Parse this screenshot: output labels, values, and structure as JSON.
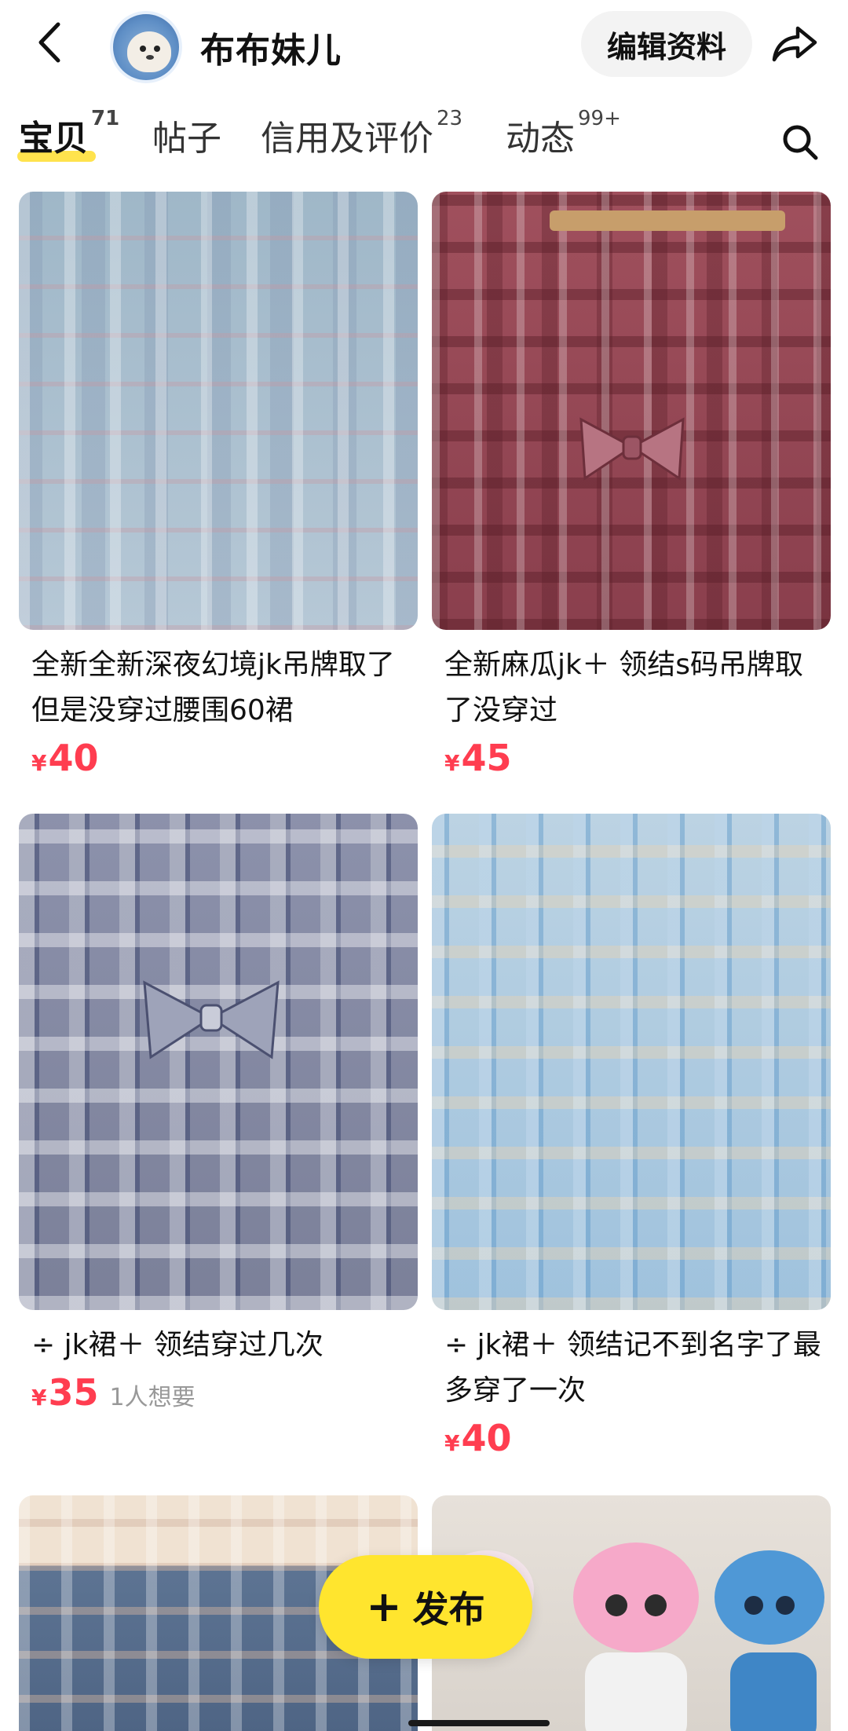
{
  "header": {
    "shop_name": "布布妹儿",
    "edit_label": "编辑资料"
  },
  "tabs": [
    {
      "label": "宝贝",
      "count": "71",
      "active": true
    },
    {
      "label": "帖子",
      "count": ""
    },
    {
      "label": "信用及评价",
      "count": "23"
    },
    {
      "label": "动态",
      "count": "99+"
    }
  ],
  "listings": [
    {
      "title": "全新全新深夜幻境jk吊牌取了但是没穿过腰围60裙",
      "currency": "¥",
      "price": "40",
      "want": ""
    },
    {
      "title": "全新麻瓜jk＋ 领结s码吊牌取了没穿过",
      "currency": "¥",
      "price": "45",
      "want": ""
    },
    {
      "title": "÷ jk裙＋ 领结穿过几次",
      "currency": "¥",
      "price": "35",
      "want": "1人想要"
    },
    {
      "title": "÷ jk裙＋ 领结记不到名字了最多穿了一次",
      "currency": "¥",
      "price": "40",
      "want": ""
    }
  ],
  "fab": {
    "label": "发布",
    "icon": "plus-icon"
  },
  "icons": {
    "back": "chevron-left-icon",
    "share": "share-arrow-icon",
    "search": "search-icon"
  },
  "colors": {
    "accent_yellow": "#ffe34d",
    "price_red": "#ff3d50",
    "fab_yellow": "#ffe52e"
  }
}
